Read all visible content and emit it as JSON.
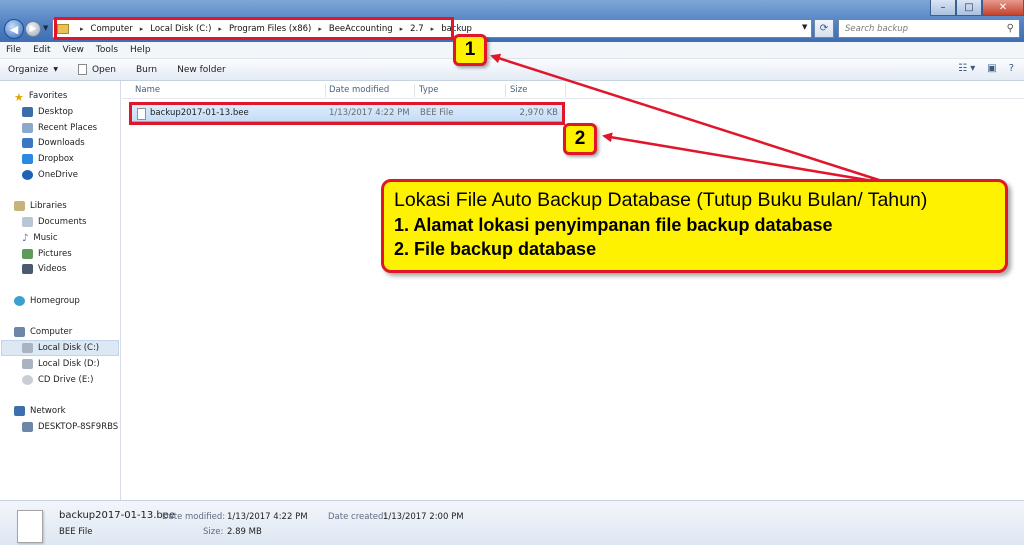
{
  "window": {
    "minimize": "–",
    "maximize": "□",
    "close": "✕"
  },
  "address_bar": {
    "crumbs": [
      "Computer",
      "Local Disk (C:)",
      "Program Files (x86)",
      "BeeAccounting",
      "2.7",
      "backup"
    ],
    "separator": "▸"
  },
  "search": {
    "placeholder": "Search backup"
  },
  "menu": [
    "File",
    "Edit",
    "View",
    "Tools",
    "Help"
  ],
  "toolbar": {
    "organize": "Organize",
    "open": "Open",
    "burn": "Burn",
    "new_folder": "New folder"
  },
  "nav": {
    "favorites": "Favorites",
    "desktop": "Desktop",
    "recent_places": "Recent Places",
    "downloads": "Downloads",
    "dropbox": "Dropbox",
    "onedrive": "OneDrive",
    "libraries": "Libraries",
    "documents": "Documents",
    "music": "Music",
    "pictures": "Pictures",
    "videos": "Videos",
    "homegroup": "Homegroup",
    "computer": "Computer",
    "local_c": "Local Disk (C:)",
    "local_d": "Local Disk (D:)",
    "cd_drive": "CD Drive (E:)",
    "network": "Network",
    "desktop_pc": "DESKTOP-8SF9RBS"
  },
  "columns": {
    "name": "Name",
    "date_modified": "Date modified",
    "type": "Type",
    "size": "Size"
  },
  "files": [
    {
      "name": "backup2017-01-13.bee",
      "date_modified": "1/13/2017 4:22 PM",
      "type": "BEE File",
      "size": "2,970 KB"
    }
  ],
  "annotations": {
    "badge_1": "1",
    "badge_2": "2",
    "callout_title": "Lokasi File Auto Backup Database (Tutup Buku Bulan/ Tahun)",
    "callout_line_1": "1. Alamat lokasi penyimpanan file backup database",
    "callout_line_2": "2. File backup database",
    "accent_color": "#e0162b",
    "callout_color": "#fff200"
  },
  "details": {
    "file_name": "backup2017-01-13.bee",
    "file_type": "BEE File",
    "date_modified_label": "Date modified:",
    "date_modified": "1/13/2017 4:22 PM",
    "size_label": "Size:",
    "size": "2.89 MB",
    "date_created_label": "Date created:",
    "date_created": "1/13/2017 2:00 PM"
  }
}
